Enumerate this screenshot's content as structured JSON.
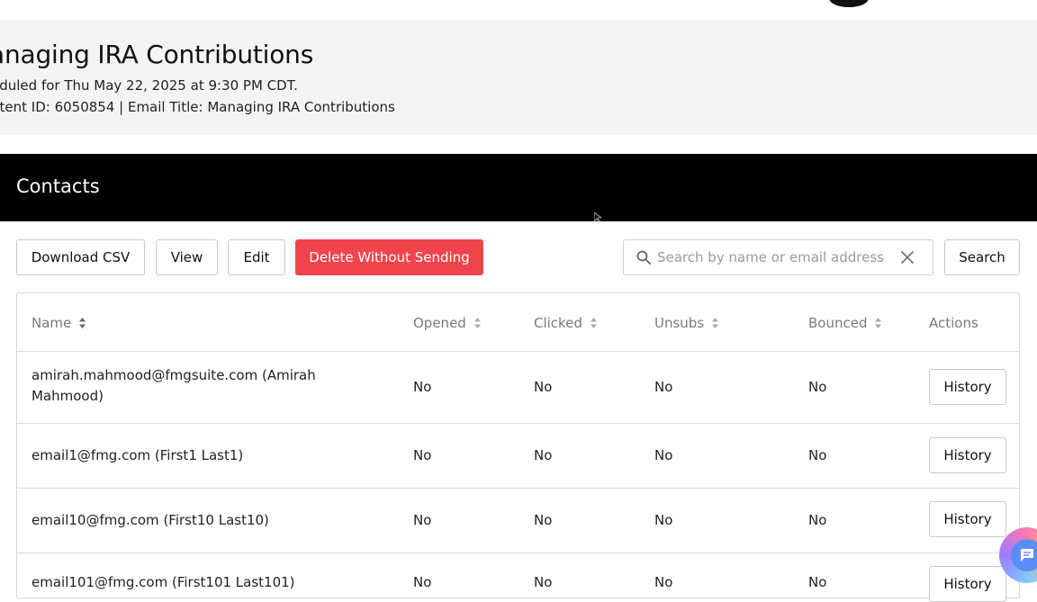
{
  "header": {
    "title": "anaging IRA Contributions",
    "scheduled": "eduled for Thu May 22, 2025 at 9:30 PM CDT.",
    "content_info": "ntent ID: 6050854 | Email Title: Managing IRA Contributions"
  },
  "contacts": {
    "section_title": "Contacts"
  },
  "toolbar": {
    "download_csv": "Download CSV",
    "view": "View",
    "edit": "Edit",
    "delete": "Delete Without Sending",
    "search_placeholder": "Search by name or email address",
    "search_button": "Search"
  },
  "table": {
    "columns": [
      "Name",
      "Opened",
      "Clicked",
      "Unsubs",
      "Bounced",
      "Actions"
    ],
    "rows": [
      {
        "name": "amirah.mahmood@fmgsuite.com (Amirah Mahmood)",
        "opened": "No",
        "clicked": "No",
        "unsubs": "No",
        "bounced": "No",
        "action": "History"
      },
      {
        "name": "email1@fmg.com (First1 Last1)",
        "opened": "No",
        "clicked": "No",
        "unsubs": "No",
        "bounced": "No",
        "action": "History"
      },
      {
        "name": "email10@fmg.com (First10 Last10)",
        "opened": "No",
        "clicked": "No",
        "unsubs": "No",
        "bounced": "No",
        "action": "History"
      },
      {
        "name": "email101@fmg.com (First101 Last101)",
        "opened": "No",
        "clicked": "No",
        "unsubs": "No",
        "bounced": "No",
        "action": "History"
      }
    ]
  },
  "colors": {
    "delete_button": "#f0444c",
    "contacts_bar": "#000000",
    "header_band": "#f4f4f4"
  },
  "icons": {
    "search": "search-icon",
    "clear": "close-icon",
    "sort": "sort-icon",
    "chat": "chat-icon"
  }
}
